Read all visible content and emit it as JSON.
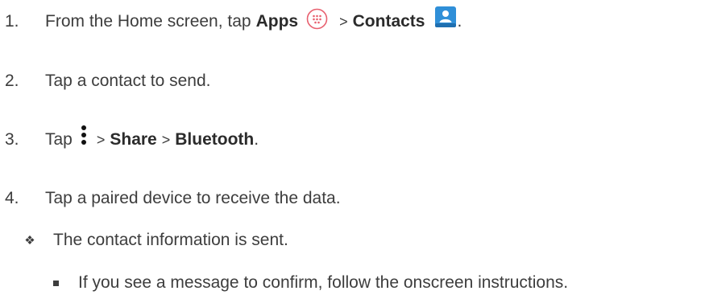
{
  "steps": [
    {
      "number": "1.",
      "text_before": "From the Home screen, tap",
      "apps_label": "Apps",
      "separator": ">",
      "contacts_label": "Contacts",
      "end": "."
    },
    {
      "number": "2.",
      "text": "Tap a contact to send."
    },
    {
      "number": "3.",
      "text_before": "Tap",
      "separator1": ">",
      "share_label": "Share",
      "separator2": ">",
      "bluetooth_label": "Bluetooth",
      "end": "."
    },
    {
      "number": "4.",
      "text": "Tap a paired device to receive the data."
    }
  ],
  "result": {
    "bullet": "❖",
    "text": "The contact information is sent."
  },
  "note": {
    "text": "If you see a message to confirm, follow the onscreen instructions."
  },
  "icons": {
    "apps": "apps-icon",
    "contacts": "contacts-icon",
    "menu": "menu-icon",
    "colors": {
      "apps_icon": "#e8606f",
      "contacts_icon": "#2f8fd8"
    }
  }
}
